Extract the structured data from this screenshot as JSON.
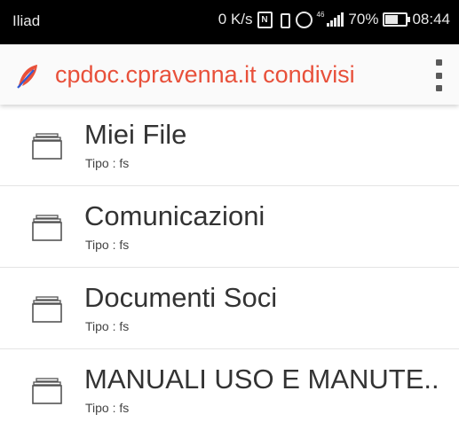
{
  "status_bar": {
    "carrier": "Iliad",
    "speed": "0 K/s",
    "network_badge": "46",
    "battery_level": 70,
    "battery_text": "70%",
    "time": "08:44"
  },
  "app_bar": {
    "title": "cpdoc.cpravenna.it condivisi",
    "accent_color": "#e8503a",
    "icons": [
      "feather-icon",
      "overflow-menu-icon"
    ]
  },
  "files": [
    {
      "name": "Miei File",
      "type": "Tipo : fs",
      "icon": "folder-icon"
    },
    {
      "name": "Comunicazioni",
      "type": "Tipo : fs",
      "icon": "folder-icon"
    },
    {
      "name": "Documenti Soci",
      "type": "Tipo : fs",
      "icon": "folder-icon"
    },
    {
      "name": "MANUALI USO E MANUTE..",
      "type": "Tipo : fs",
      "icon": "folder-icon"
    }
  ]
}
